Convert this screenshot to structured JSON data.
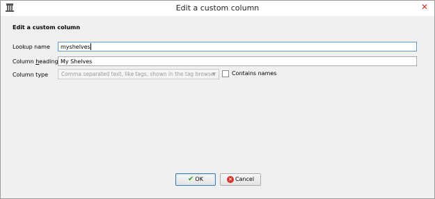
{
  "window": {
    "title": "Edit a custom column",
    "app_icon": "calibre-library-icon",
    "close_icon": "close-icon"
  },
  "form": {
    "heading": "Edit a custom column",
    "lookup_name": {
      "label": "Lookup name",
      "value": "myshelves"
    },
    "column_heading": {
      "label_prefix": "Column ",
      "label_access": "h",
      "label_rest": "eading",
      "value": "My Shelves"
    },
    "column_type": {
      "label": "Column type",
      "selected": "Comma separated text, like tags, shown in the tag browser",
      "enabled": false
    },
    "contains_names": {
      "label": "Contains names",
      "checked": false
    }
  },
  "buttons": {
    "ok_label": "OK",
    "cancel_label": "Cancel"
  },
  "colors": {
    "focus_border": "#5c9bd1",
    "close": "#d0302d",
    "ok_icon": "#2f9a2f",
    "cancel_icon": "#d4332c"
  }
}
